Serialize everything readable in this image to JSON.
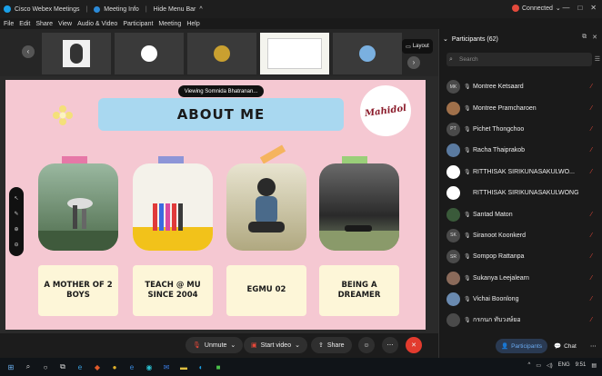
{
  "window": {
    "app_title": "Cisco Webex Meetings",
    "meeting_info": "Meeting Info",
    "hide_menu": "Hide Menu Bar",
    "connection_status": "Connected"
  },
  "menu": [
    "File",
    "Edit",
    "Share",
    "View",
    "Audio & Video",
    "Participant",
    "Meeting",
    "Help"
  ],
  "video_strip": {
    "layout_label": "Layout"
  },
  "slide": {
    "viewing_banner": "Viewing Somnida Bhatranan...",
    "heading": "ABOUT ME",
    "logo_text": "Mahidol",
    "cards": [
      {
        "caption": "A MOTHER OF 2 BOYS"
      },
      {
        "caption": "TEACH @ MU SINCE 2004"
      },
      {
        "caption": "EGMU 02"
      },
      {
        "caption": "BEING A DREAMER"
      }
    ]
  },
  "controls": {
    "unmute": "Unmute",
    "start_video": "Start video",
    "share": "Share"
  },
  "participants": {
    "header": "Participants (62)",
    "search_placeholder": "Search",
    "list": [
      {
        "initials": "MK",
        "name": "Montree Ketsaard",
        "avatar_color": "#4a4a4a"
      },
      {
        "initials": "",
        "name": "Montree Pramcharoen",
        "avatar_color": "#a0704a"
      },
      {
        "initials": "PT",
        "name": "Pichet Thongchoo",
        "avatar_color": "#4a4a4a"
      },
      {
        "initials": "",
        "name": "Racha Thaiprakob",
        "avatar_color": "#5a7aa0"
      },
      {
        "initials": "",
        "name": "RITTHISAK SIRIKUNASAKULWO...",
        "avatar_color": "#ffffff"
      },
      {
        "initials": "",
        "name": "RITTHISAK SIRIKUNASAKULWONG",
        "avatar_color": "#ffffff"
      },
      {
        "initials": "",
        "name": "Santad Maton",
        "avatar_color": "#3a5a3a"
      },
      {
        "initials": "SK",
        "name": "Siranoot Koonkerd",
        "avatar_color": "#4a4a4a"
      },
      {
        "initials": "SR",
        "name": "Sompop Rattanpa",
        "avatar_color": "#4a4a4a"
      },
      {
        "initials": "",
        "name": "Sukanya Leejalearn",
        "avatar_color": "#8a6a5a"
      },
      {
        "initials": "",
        "name": "Vichai Boonlong",
        "avatar_color": "#6a8ab0"
      },
      {
        "initials": "",
        "name": "กรกนก ทับวงษ์ยอ",
        "avatar_color": "#4a4a4a"
      }
    ],
    "participants_tab": "Participants",
    "chat_tab": "Chat"
  },
  "taskbar": {
    "lang": "ENG",
    "time": "9:51"
  },
  "colors": {
    "slide_bg": "#f5c8d2",
    "heading_bar": "#a9d8f0",
    "caption_bg": "#fdf6d8",
    "end_button": "#e23b2e",
    "muted_icon": "#e8483a",
    "active_tab": "#3a8ee8"
  }
}
